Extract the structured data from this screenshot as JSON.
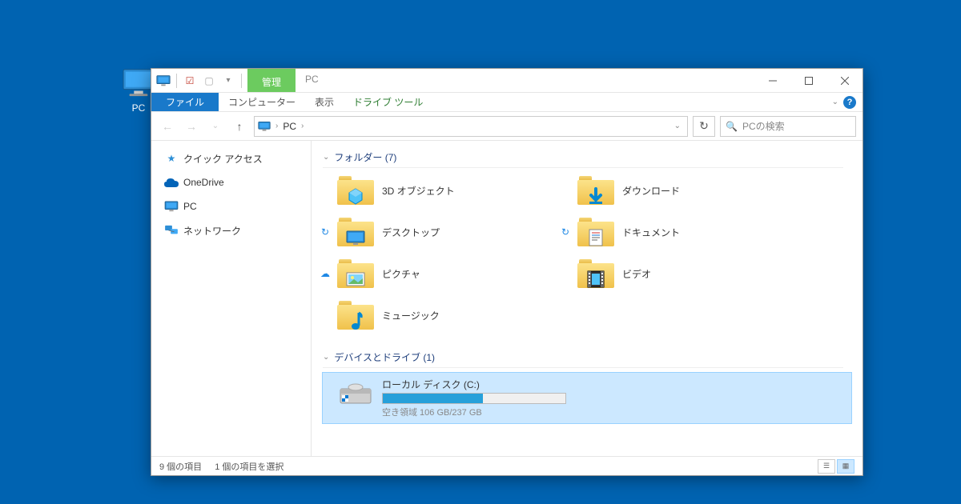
{
  "desktop": {
    "pc_label": "PC"
  },
  "titlebar": {
    "contextual_group": "管理",
    "title": "PC"
  },
  "ribbon": {
    "file": "ファイル",
    "computer": "コンピューター",
    "view": "表示",
    "drive_tools": "ドライブ ツール"
  },
  "addressbar": {
    "location": "PC",
    "search_placeholder": "PCの検索"
  },
  "sidebar": {
    "items": [
      {
        "label": "クイック アクセス",
        "icon": "quickaccess"
      },
      {
        "label": "OneDrive",
        "icon": "onedrive"
      },
      {
        "label": "PC",
        "icon": "pc"
      },
      {
        "label": "ネットワーク",
        "icon": "network"
      }
    ]
  },
  "content": {
    "folders_header": "フォルダー (7)",
    "folders": [
      {
        "label": "3D オブジェクト",
        "overlay": "3d",
        "status": ""
      },
      {
        "label": "ダウンロード",
        "overlay": "download",
        "status": ""
      },
      {
        "label": "デスクトップ",
        "overlay": "desktop",
        "status": "sync"
      },
      {
        "label": "ドキュメント",
        "overlay": "document",
        "status": "sync"
      },
      {
        "label": "ピクチャ",
        "overlay": "picture",
        "status": "cloud"
      },
      {
        "label": "ビデオ",
        "overlay": "video",
        "status": ""
      },
      {
        "label": "ミュージック",
        "overlay": "music",
        "status": ""
      }
    ],
    "drives_header": "デバイスとドライブ (1)",
    "drive": {
      "name": "ローカル ディスク (C:)",
      "free_text": "空き領域 106 GB/237 GB",
      "used_percent": 55
    }
  },
  "statusbar": {
    "count": "9 個の項目",
    "selection": "1 個の項目を選択"
  }
}
